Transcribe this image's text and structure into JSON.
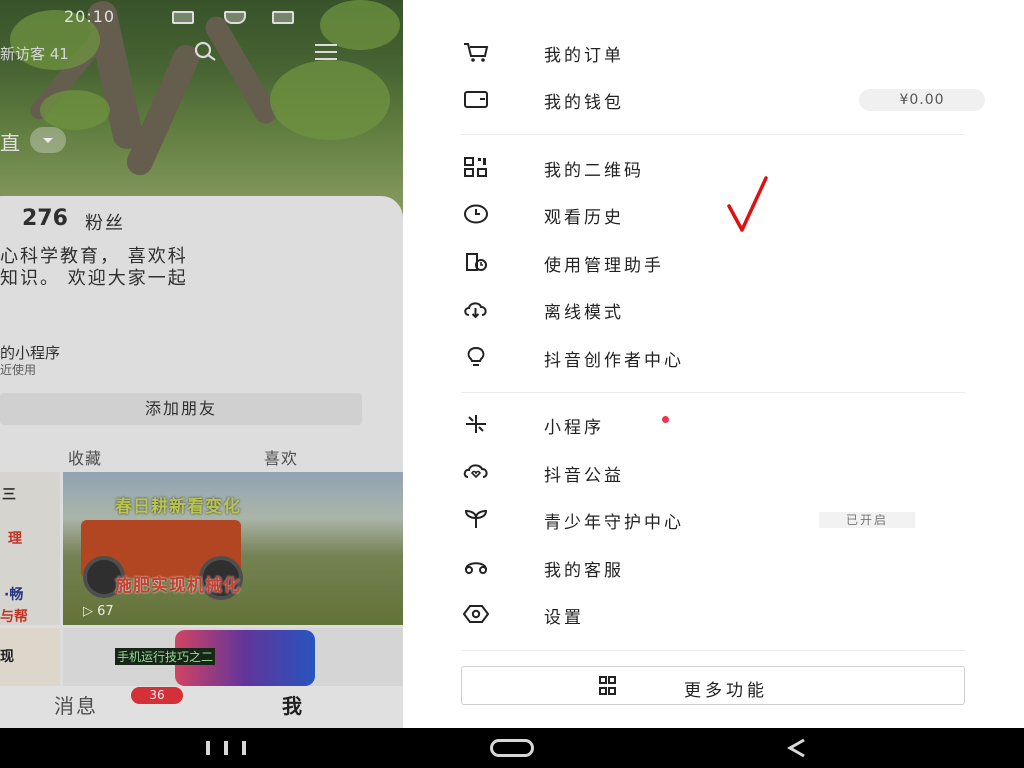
{
  "status_bar": {
    "time": "20:10"
  },
  "profile": {
    "visitors_text": "新访客 41",
    "name_fragment": "直",
    "fans_count": "276",
    "fans_label": "粉丝",
    "bio_line1": "心科学教育， 喜欢科",
    "bio_line2": "知识。 欢迎大家一起",
    "mini_program_title": "的小程序",
    "mini_program_sub": "近使用",
    "add_friend_label": "添加朋友",
    "tabs": {
      "favorites": "收藏",
      "likes": "喜欢"
    },
    "video1": {
      "caption_top": "春日耕新看变化",
      "caption_bottom": "施肥实现机械化",
      "plays": "67"
    },
    "video2": {
      "caption": "手机运行技巧之二"
    },
    "left_thumb_texts": [
      "三",
      "理",
      "·畅",
      "与帮",
      "现"
    ]
  },
  "bottom_nav": {
    "messages_label": "消息",
    "messages_badge": "36",
    "me_label": "我"
  },
  "drawer": {
    "items": [
      {
        "label": "我的订单",
        "icon": "cart-icon"
      },
      {
        "label": "我的钱包",
        "icon": "wallet-icon",
        "balance": "¥0.00"
      },
      {
        "label": "我的二维码",
        "icon": "qrcode-icon"
      },
      {
        "label": "观看历史",
        "icon": "clock-icon"
      },
      {
        "label": "使用管理助手",
        "icon": "phone-manage-icon"
      },
      {
        "label": "离线模式",
        "icon": "cloud-download-icon"
      },
      {
        "label": "抖音创作者中心",
        "icon": "bulb-icon"
      },
      {
        "label": "小程序",
        "icon": "asterisk-icon"
      },
      {
        "label": "抖音公益",
        "icon": "charity-cloud-icon"
      },
      {
        "label": "青少年守护中心",
        "icon": "sprout-icon",
        "badge": "已开启"
      },
      {
        "label": "我的客服",
        "icon": "headset-icon"
      },
      {
        "label": "设置",
        "icon": "settings-hex-icon"
      }
    ],
    "more_button_label": "更多功能",
    "annotation_mark": "√"
  },
  "colors": {
    "accent_red": "#f0334f",
    "badge_red": "#e8333d",
    "annotation_red": "#e01010"
  }
}
